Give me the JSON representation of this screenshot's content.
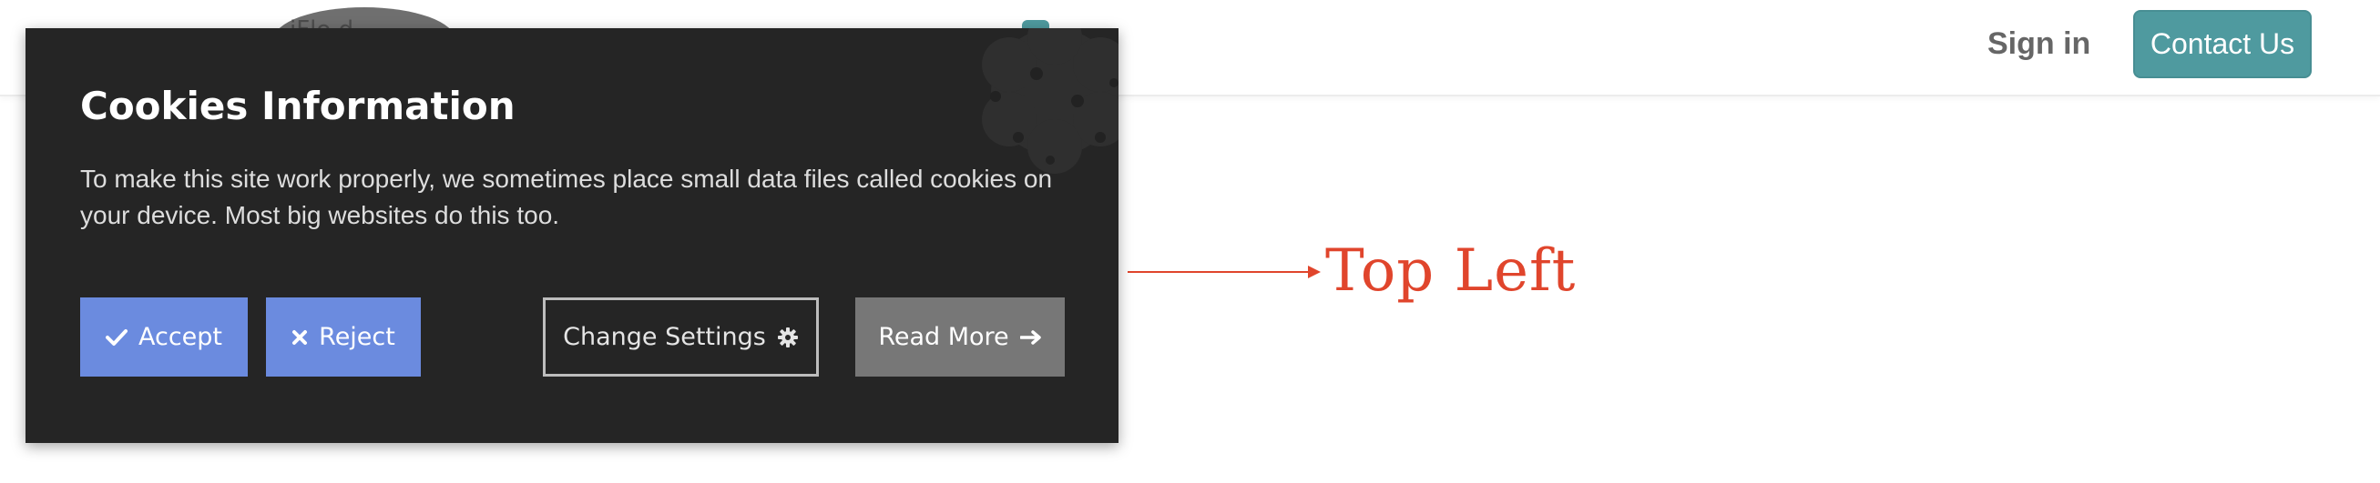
{
  "header": {
    "logo_text": "iFlo d",
    "sign_in_label": "Sign in",
    "contact_label": "Contact Us",
    "accent_color": "#4f9a9f"
  },
  "annotation": {
    "label": "Top Left",
    "color": "#e0452c"
  },
  "cookie_panel": {
    "title": "Cookies Information",
    "message": "To make this site work properly, we sometimes place small data files called cookies on your device. Most big websites do this too.",
    "buttons": {
      "accept_label": "Accept",
      "accept_icon": "check-icon",
      "reject_label": "Reject",
      "reject_icon": "close-icon",
      "settings_label": "Change Settings",
      "settings_icon": "gear-icon",
      "read_more_label": "Read More",
      "read_more_icon": "arrow-right-icon"
    },
    "colors": {
      "background": "#252525",
      "primary_button": "#6b8bdf",
      "secondary_button": "#777777"
    }
  }
}
